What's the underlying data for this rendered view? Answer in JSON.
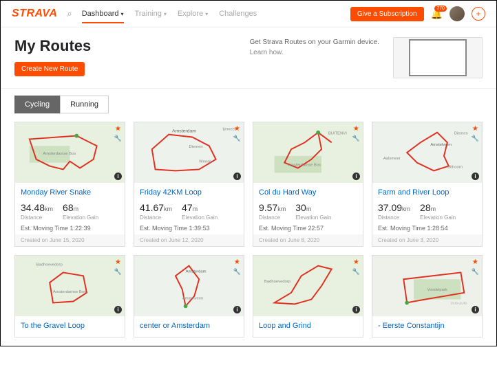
{
  "header": {
    "logo": "STRAVA",
    "nav": [
      {
        "label": "Dashboard",
        "active": true
      },
      {
        "label": "Training",
        "active": false
      },
      {
        "label": "Explore",
        "active": false
      },
      {
        "label": "Challenges",
        "active": false
      }
    ],
    "cta": "Give a Subscription",
    "badge": "770"
  },
  "hero": {
    "title": "My Routes",
    "button": "Create New Route",
    "promo_line1": "Get Strava Routes on your Garmin device.",
    "promo_link": "Learn how."
  },
  "tabs": [
    {
      "label": "Cycling",
      "active": true
    },
    {
      "label": "Running",
      "active": false
    }
  ],
  "labels": {
    "distance": "Distance",
    "elevation": "Elevation Gain",
    "est_prefix": "Est. Moving Time",
    "created_prefix": "Created on"
  },
  "routes": [
    {
      "name": "Monday River Snake",
      "dist": "34.48",
      "dist_u": "km",
      "elev": "68",
      "elev_u": "m",
      "time": "1:22:39",
      "date": "June 15, 2020"
    },
    {
      "name": "Friday 42KM Loop",
      "dist": "41.67",
      "dist_u": "km",
      "elev": "47",
      "elev_u": "m",
      "time": "1:39:53",
      "date": "June 12, 2020"
    },
    {
      "name": "Col du Hard Way",
      "dist": "9.57",
      "dist_u": "km",
      "elev": "30",
      "elev_u": "m",
      "time": "22:57",
      "date": "June 8, 2020"
    },
    {
      "name": "Farm and River Loop",
      "dist": "37.09",
      "dist_u": "km",
      "elev": "28",
      "elev_u": "m",
      "time": "1:28:54",
      "date": "June 3, 2020"
    }
  ],
  "routes_partial": [
    {
      "name": "To the Gravel Loop"
    },
    {
      "name": "center or Amsterdam"
    },
    {
      "name": "Loop and Grind"
    },
    {
      "name": "- Eerste Constantijn"
    }
  ],
  "map_texts": {
    "r0": "Amsterdamse Bos",
    "r1a": "Amsterdam",
    "r1b": "Diemen",
    "r1c": "Weesp",
    "r2a": "BUITENVI",
    "r2b": "Amsterdamse Bos",
    "r3a": "Amstelveen",
    "r3b": "Aalsmeer",
    "r3c": "Uithoorn",
    "r3d": "Diemen",
    "p0a": "Badhoevedorp",
    "p0b": "Amsterdamse Bos",
    "p1a": "Amsterdam",
    "p1b": "Amstelveen",
    "p2": "Badhoevedorp",
    "p3": "Vondelpark"
  }
}
